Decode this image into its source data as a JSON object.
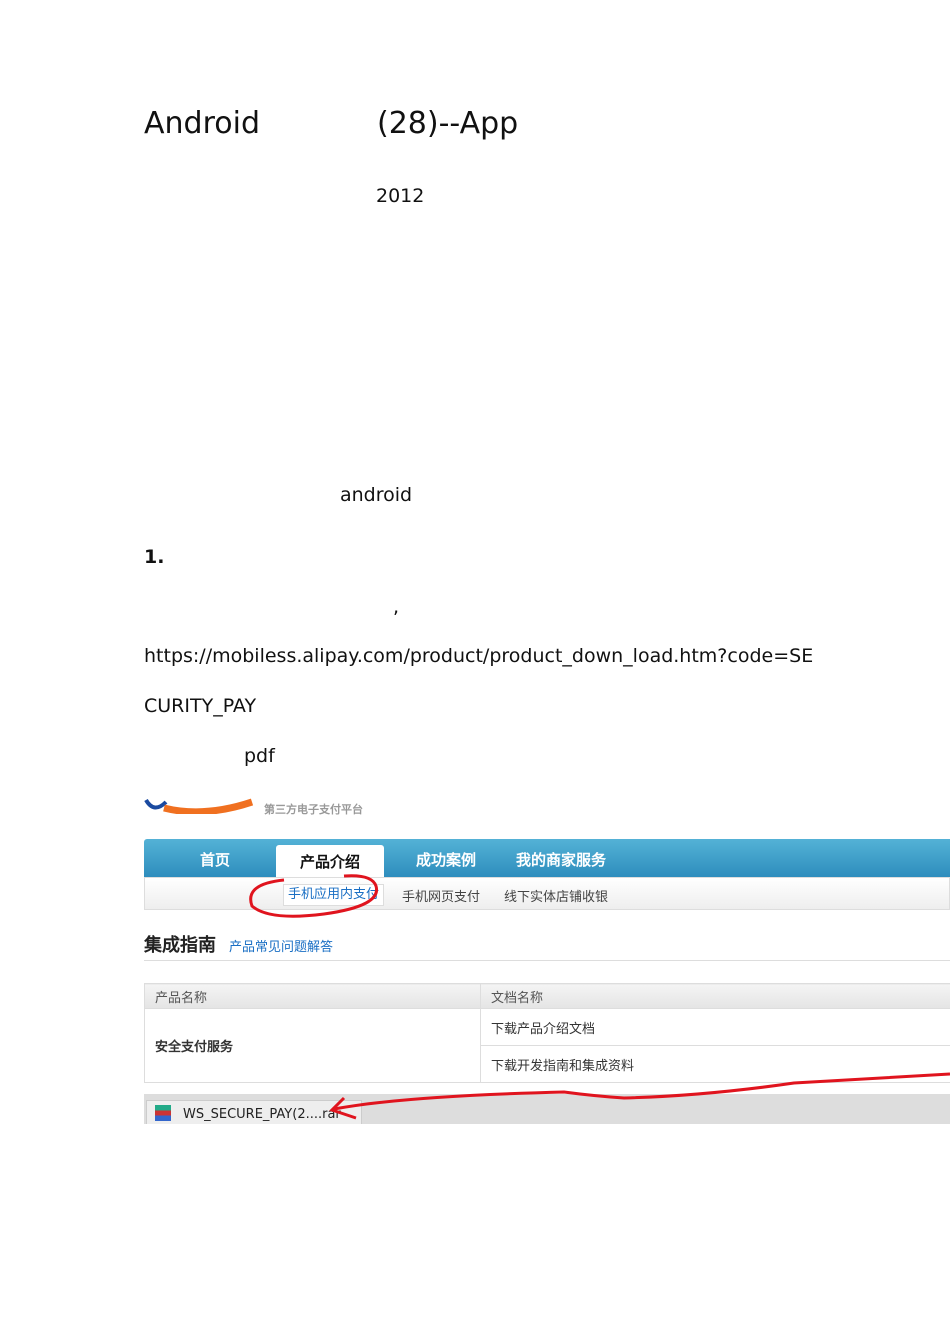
{
  "doc": {
    "title_left": "Android",
    "title_right": "(28)--App",
    "year": "2012",
    "android": "android",
    "step": "1.",
    "comma": ",",
    "url_line1": "https://mobiless.alipay.com/product/product_down_load.htm?code=SE",
    "url_line2": "CURITY_PAY",
    "pdf": "pdf"
  },
  "screenshot": {
    "slogan": "第三方电子支付平台",
    "nav": [
      "首页",
      "产品介绍",
      "成功案例",
      "我的商家服务"
    ],
    "subnav": [
      "手机应用内支付",
      "手机网页支付",
      "线下实体店铺收银"
    ],
    "section_title": "集成指南",
    "faq_link": "产品常见问题解答",
    "table": {
      "headers": [
        "产品名称",
        "文档名称"
      ],
      "product": "安全支付服务",
      "docs": [
        "下载产品介绍文档",
        "下载开发指南和集成资料"
      ]
    },
    "download_file": "WS_SECURE_PAY(2....rar",
    "colors": {
      "nav": "#3a9cc8",
      "link": "#1a6fc4",
      "annotation": "#e0141e"
    }
  }
}
